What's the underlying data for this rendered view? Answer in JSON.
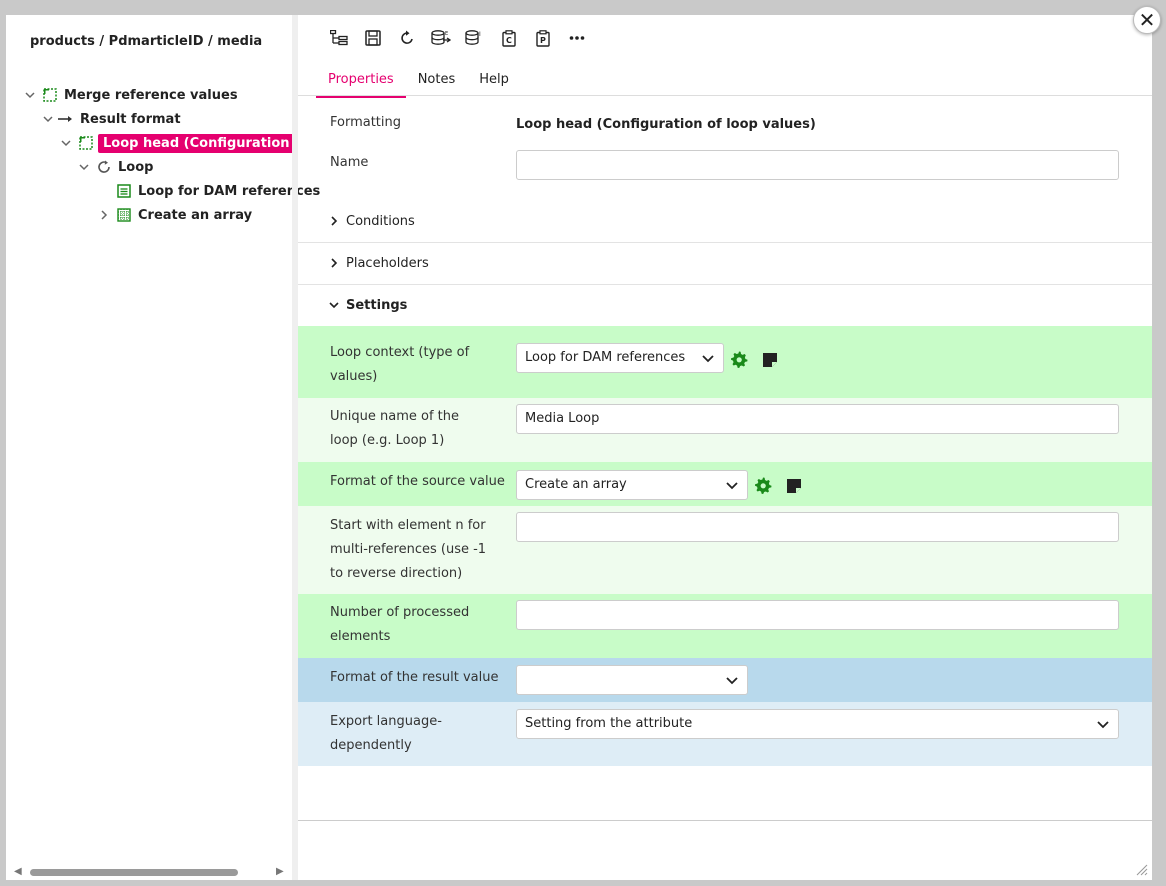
{
  "breadcrumb": "products / PdmarticleID / media",
  "tree": {
    "items": [
      {
        "label": "Merge reference values"
      },
      {
        "label": "Result format"
      },
      {
        "label": "Loop head (Configuration of loop"
      },
      {
        "label": "Loop"
      },
      {
        "label": "Loop for DAM references"
      },
      {
        "label": "Create an array"
      }
    ]
  },
  "tabs": [
    "Properties",
    "Notes",
    "Help"
  ],
  "form": {
    "formatting_label": "Formatting",
    "formatting_value": "Loop head (Configuration of loop values)",
    "name_label": "Name",
    "name_value": ""
  },
  "sections": {
    "conditions": "Conditions",
    "placeholders": "Placeholders",
    "settings": "Settings"
  },
  "settings": {
    "loop_context_label": "Loop context (type of values)",
    "loop_context_value": "Loop for DAM references",
    "unique_name_label": "Unique name of the loop (e.g. Loop 1)",
    "unique_name_value": "Media Loop",
    "source_format_label": "Format of the source value",
    "source_format_value": "Create an array",
    "start_element_label": "Start with element n for multi-references (use -1 to reverse direction)",
    "start_element_value": "",
    "num_processed_label": "Number of processed elements",
    "num_processed_value": "",
    "result_format_label": "Format of the result value",
    "result_format_value": "",
    "export_lang_label": "Export language-dependently",
    "export_lang_value": "Setting from the attribute"
  },
  "colors": {
    "accent": "#e5006f",
    "green_band": "#c8fcc8",
    "green_band_light": "#effcee",
    "blue_band": "#b8d9ec",
    "blue_band_light": "#deedf6",
    "gear_green": "#1a8a1a"
  },
  "close_label": "✕"
}
